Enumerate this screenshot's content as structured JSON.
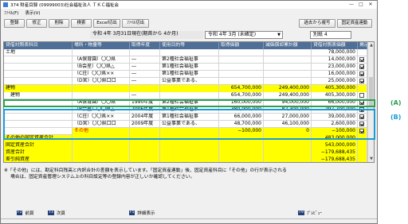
{
  "window": {
    "title": "374 財産目録 (09999003)社会福祉法人 ＴＫＣ福祉会",
    "min": "—",
    "max": "□",
    "close": "✕"
  },
  "menu": [
    "ﾌｧｲﾙ(F)",
    "表示(V)"
  ],
  "toolbar": {
    "left": [
      "登録",
      "修正",
      "削除",
      "検索",
      "Excel切出",
      "ﾌｧｲﾙ切出"
    ],
    "right": [
      "過去から複写",
      "固定資産連動"
    ]
  },
  "period": {
    "date_label": "令和 4年 3月31日現在(期首から 4か月)",
    "fiscal": "令和 4年 3月 (未確定)",
    "fiscal_arrow": "▼",
    "mode": "別紙 4"
  },
  "table": {
    "headers": [
      "貸借対照表科目",
      "場所・物量等",
      "取得年度",
      "使用目的等",
      "取得価額",
      "減価償却累計額",
      "貸借対照表価額",
      "掲示"
    ],
    "rows": [
      {
        "c": [
          "土地",
          "",
          "",
          "",
          "",
          "",
          "78,000,000",
          ""
        ],
        "chk": "none",
        "style": "plain"
      },
      {
        "c": [
          "",
          "（A保育園）〇〇県",
          "―",
          "第2種社会福祉事",
          "",
          "",
          "14,000,000",
          ""
        ],
        "chk": "on",
        "style": "plain"
      },
      {
        "c": [
          "",
          "（B会星）〇〇県△",
          "―",
          "第1種社会福祉事",
          "",
          "",
          "23,000,000",
          ""
        ],
        "chk": "on",
        "style": "plain"
      },
      {
        "c": [
          "",
          "（C荘）〇〇県××",
          "―",
          "第1種社会福祉事",
          "",
          "",
          "16,000,000",
          ""
        ],
        "chk": "on",
        "style": "plain"
      },
      {
        "c": [
          "",
          "（D宮）〇〇県口口",
          "―",
          "公益事業である、",
          "",
          "",
          "25,000,000",
          ""
        ],
        "chk": "on",
        "style": "plain"
      },
      {
        "c": [
          "建物",
          "",
          "",
          "",
          "654,700,000",
          "249,400,000",
          "405,300,000",
          ""
        ],
        "chk": "none",
        "style": "yellow"
      },
      {
        "c": [
          "建物",
          "",
          "―",
          "",
          "654,700,000",
          "249,400,000",
          "405,300,000",
          ""
        ],
        "chk": "off",
        "style": "plain",
        "indent": true
      },
      {
        "c": [
          "",
          "（A保育園）〇〇県",
          "1990年度",
          "第2種社会福祉事",
          "160,000,000",
          "94,000,000",
          "66,000,000",
          ""
        ],
        "chk": "on",
        "style": "plain"
      },
      {
        "c": [
          "",
          "（B会星）〇〇県△",
          "2006年度",
          "第1種社会福祉事",
          "380,000,000",
          "82,300,000",
          "297,700,000",
          ""
        ],
        "chk": "on",
        "style": "plain"
      },
      {
        "c": [
          "",
          "（C荘）〇〇県××",
          "2004年度",
          "第1種社会福祉事",
          "66,000,000",
          "27,000,000",
          "39,000,000",
          ""
        ],
        "chk": "on",
        "style": "plain"
      },
      {
        "c": [
          "",
          "（D宮）〇〇県口口",
          "2009年度",
          "公益事業である、",
          "48,700,000",
          "46,100,000",
          "2,600,000",
          ""
        ],
        "chk": "on",
        "style": "plain"
      },
      {
        "c": [
          "",
          "その他",
          "",
          "",
          "−100,000",
          "0",
          "−100,000",
          ""
        ],
        "chk": "on",
        "style": "yellowgap",
        "red": true
      },
      {
        "c": [
          "その他の固定資産合計",
          "",
          "",
          "",
          "",
          "",
          "483,000,000",
          ""
        ],
        "chk": "none",
        "style": "yellow"
      },
      {
        "c": [
          "固定資産合計",
          "",
          "",
          "",
          "",
          "",
          "543,000,000",
          ""
        ],
        "chk": "none",
        "style": "yellow"
      },
      {
        "c": [
          "資産合計",
          "",
          "",
          "",
          "",
          "",
          "−179,688,435",
          ""
        ],
        "chk": "none",
        "style": "yellow"
      },
      {
        "c": [
          "差引純資産",
          "",
          "",
          "",
          "",
          "",
          "−179,688,435",
          ""
        ],
        "chk": "none",
        "style": "yellow"
      }
    ]
  },
  "note": {
    "line1": "※「その他」には、勘定科目残高と内訳合計の差額を表示しています。「固定資産連動」後、固定資産科目に「その他」の行が表示される",
    "line2": "場合は、固定資産管理システム上の科目設定等の登録内容が正しいか確認してください。"
  },
  "fkeys": [
    {
      "key": "F2",
      "label": "前頁"
    },
    {
      "key": "F3",
      "label": "次頁"
    },
    {
      "key": "F5",
      "label": "詳細表示"
    },
    {
      "key": "F9",
      "label": "ﾌﾟﾚﾋﾞｭｰ"
    }
  ],
  "annotations": {
    "a": "(A)",
    "b": "(B)"
  },
  "colors": {
    "header": "#4f6f97",
    "highlight": "#ffff00",
    "annotation_a": "#2aa050",
    "annotation_b": "#1a9bd8"
  }
}
